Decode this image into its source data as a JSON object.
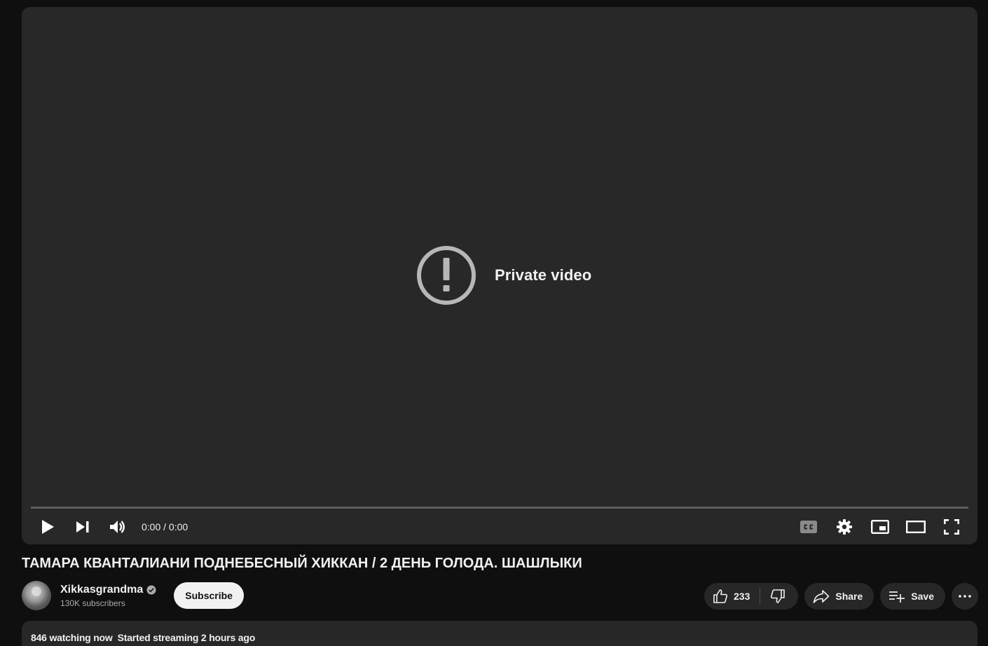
{
  "player": {
    "message": "Private video",
    "time": "0:00 / 0:00"
  },
  "video": {
    "title": "ТАМАРА КВАНТАЛИАНИ ПОДНЕБЕСНЫЙ ХИККАН / 2 ДЕНЬ ГОЛОДА. ШАШЛЫКИ"
  },
  "channel": {
    "name": "Xikkasgrandma",
    "subscribers": "130K subscribers",
    "subscribe_label": "Subscribe"
  },
  "actions": {
    "likes": "233",
    "share_label": "Share",
    "save_label": "Save"
  },
  "description": {
    "watching": "846 watching now",
    "started": "Started streaming 2 hours ago"
  },
  "icons": {
    "play": "play-icon",
    "next": "next-icon",
    "volume": "volume-icon",
    "captions": "captions-icon",
    "settings": "settings-icon",
    "miniplayer": "miniplayer-icon",
    "theater": "theater-icon",
    "fullscreen": "fullscreen-icon"
  }
}
